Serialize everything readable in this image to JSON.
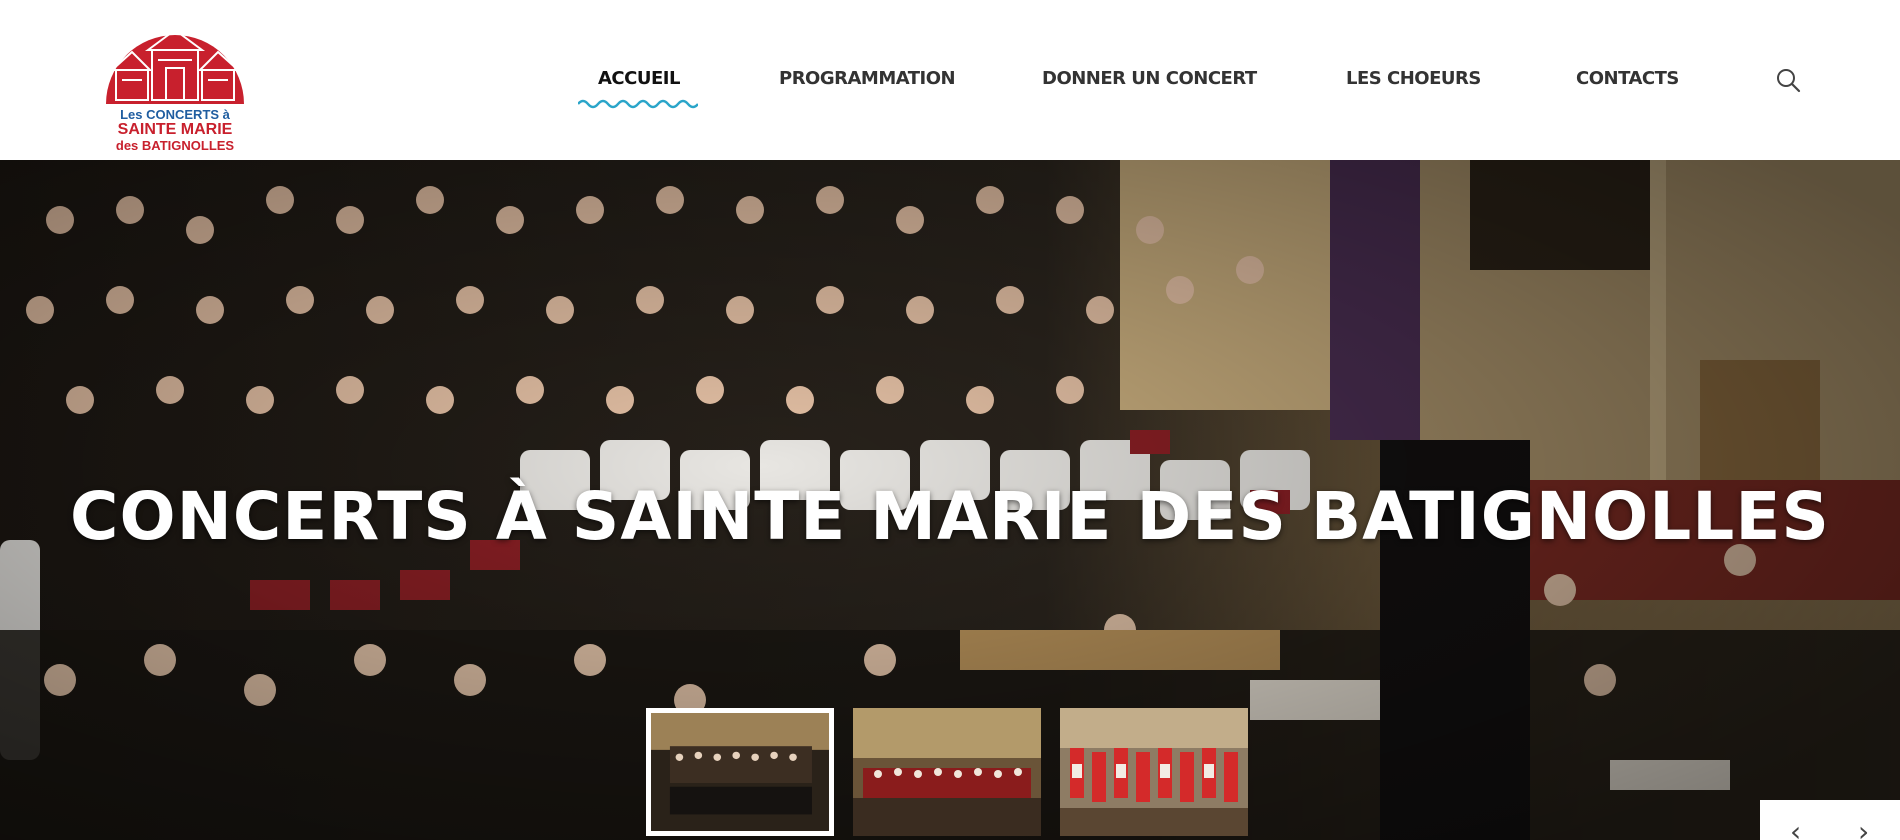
{
  "logo": {
    "line1": "Les CONCERTS à",
    "line2": "SAINTE MARIE",
    "line3": "des BATIGNOLLES",
    "brand_red": "#c8202d",
    "brand_blue": "#1f5da0"
  },
  "nav": {
    "items": [
      {
        "label": "ACCUEIL",
        "active": true
      },
      {
        "label": "PROGRAMMATION",
        "active": false
      },
      {
        "label": "DONNER UN CONCERT",
        "active": false
      },
      {
        "label": "LES CHOEURS",
        "active": false
      },
      {
        "label": "CONTACTS",
        "active": false
      }
    ],
    "accent": "#2aa5c9",
    "search_icon": "search-icon"
  },
  "hero": {
    "title": "CONCERTS À SAINTE MARIE DES BATIGNOLLES",
    "thumbnails": [
      {
        "name": "choir-orchestra",
        "active": true
      },
      {
        "name": "choir-red-stage",
        "active": false
      },
      {
        "name": "children-choir-red",
        "active": false
      }
    ],
    "prev_icon": "chevron-left-icon",
    "next_icon": "chevron-right-icon"
  }
}
